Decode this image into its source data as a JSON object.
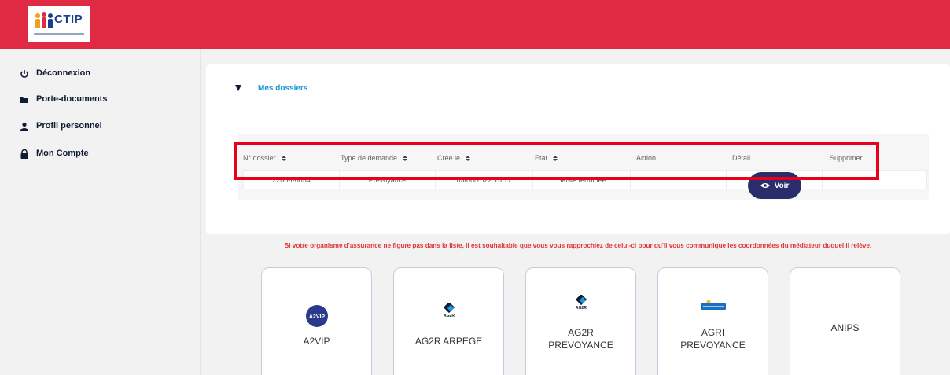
{
  "header": {
    "logo_text": "CTIP"
  },
  "sidebar": {
    "items": [
      {
        "label": "Déconnexion",
        "icon": "power-icon"
      },
      {
        "label": "Porte-documents",
        "icon": "folder-icon"
      },
      {
        "label": "Profil personnel",
        "icon": "user-icon"
      },
      {
        "label": "Mon Compte",
        "icon": "lock-icon"
      }
    ]
  },
  "panel": {
    "title": "Mes dossiers",
    "table": {
      "columns": [
        "N° dossier",
        "Type de demande",
        "Créé le",
        "Etat",
        "Action",
        "Détail",
        "Supprimer"
      ],
      "sortable": [
        true,
        true,
        true,
        true,
        false,
        false,
        false
      ],
      "rows": [
        {
          "dossier": "2206-I-6054",
          "type": "Prevoyance",
          "cree_le": "03/06/2022 15:17",
          "etat": "Saisie terminée",
          "action": "",
          "detail_button": "Voir",
          "supprimer": ""
        }
      ]
    }
  },
  "notice": "Si votre organisme d'assurance ne figure pas dans la liste, il est souhaitable que vous vous rapprochiez de celui-ci pour qu'il vous communique les coordonnées du médiateur duquel il relève.",
  "organizations": [
    {
      "line1": "A2VIP",
      "line2": "",
      "logo_text": "A2VIP"
    },
    {
      "line1": "AG2R ARPEGE",
      "line2": "",
      "logo_text": "AG2R"
    },
    {
      "line1": "AG2R",
      "line2": "PREVOYANCE",
      "logo_text": "AG2R"
    },
    {
      "line1": "AGRI",
      "line2": "PREVOYANCE",
      "logo_text": ""
    },
    {
      "line1": "ANIPS",
      "line2": "",
      "logo_text": ""
    }
  ],
  "colors": {
    "header_red": "#e02a44",
    "accent_blue": "#1a9ad6",
    "button_navy": "#2a2d6c",
    "notice_red": "#e23434",
    "highlight_red": "#e8001c"
  }
}
